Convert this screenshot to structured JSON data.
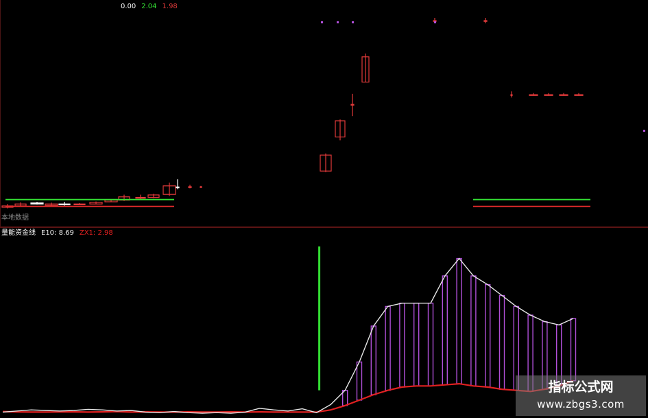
{
  "readout": {
    "main_prefix": "0.00",
    "main_mid": "2.04",
    "main_right": "1.98",
    "sub_label": "本地数据",
    "ind_name": "量能资金线",
    "ind_e10": "E10: 8.69",
    "ind_zx1": "ZX1: 2.98"
  },
  "colors": {
    "up": "#e23a3a",
    "down": "#ffffff",
    "e10": "#e6e6e6",
    "zx1": "#e02020",
    "bars": "#b04fd8",
    "green_line": "#33dd33",
    "red_line": "#dd2a2a",
    "divider": "#7a1a1a"
  },
  "watermark": {
    "title": "指标公式网",
    "url": "www.zbgs3.com"
  },
  "chart_data": [
    {
      "type": "candlestick",
      "panel": "price",
      "x": [
        0,
        1,
        2,
        3,
        4,
        5,
        6,
        7,
        8,
        9,
        10,
        11,
        12,
        13,
        14,
        15,
        16,
        17,
        18,
        19,
        20,
        21,
        22,
        23,
        24,
        25
      ],
      "candles": [
        {
          "x": 0,
          "open": 0.1,
          "close": 0.15,
          "high": 0.22,
          "low": 0.06
        },
        {
          "x": 1,
          "open": 0.15,
          "close": 0.22,
          "high": 0.28,
          "low": 0.12
        },
        {
          "x": 2,
          "open": 0.26,
          "close": 0.22,
          "high": 0.3,
          "low": 0.2
        },
        {
          "x": 3,
          "open": 0.17,
          "close": 0.22,
          "high": 0.27,
          "low": 0.13
        },
        {
          "x": 4,
          "open": 0.22,
          "close": 0.21,
          "high": 0.3,
          "low": 0.16
        },
        {
          "x": 5,
          "open": 0.2,
          "close": 0.22,
          "high": 0.25,
          "low": 0.18
        },
        {
          "x": 6,
          "open": 0.22,
          "close": 0.28,
          "high": 0.31,
          "low": 0.21
        },
        {
          "x": 7,
          "open": 0.3,
          "close": 0.36,
          "high": 0.4,
          "low": 0.29
        },
        {
          "x": 8,
          "open": 0.36,
          "close": 0.48,
          "high": 0.56,
          "low": 0.33
        },
        {
          "x": 9,
          "open": 0.45,
          "close": 0.46,
          "high": 0.56,
          "low": 0.4
        },
        {
          "x": 10,
          "open": 0.46,
          "close": 0.55,
          "high": 0.59,
          "low": 0.43
        },
        {
          "x": 11,
          "open": 0.57,
          "close": 0.88,
          "high": 1.0,
          "low": 0.51
        },
        {
          "x": 12,
          "open": 0.84,
          "close": 0.83,
          "high": 1.12,
          "low": 0.76
        },
        {
          "x": 13,
          "open": 0.83,
          "close": 0.85,
          "high": 0.92,
          "low": 0.79
        },
        {
          "x": 14,
          "open": 0.85,
          "close": 0.85,
          "high": 0.88,
          "low": 0.84
        },
        {
          "x": 15,
          "open": 1.42,
          "close": 2.0,
          "high": 2.06,
          "low": 1.38
        },
        {
          "x": 16,
          "open": 2.66,
          "close": 3.25,
          "high": 3.3,
          "low": 2.54
        },
        {
          "x": 17,
          "open": 3.85,
          "close": 3.85,
          "high": 4.23,
          "low": 3.42
        },
        {
          "x": 18,
          "open": 4.66,
          "close": 5.58,
          "high": 5.7,
          "low": 4.66
        },
        {
          "x": 19,
          "open": 6.9,
          "close": 6.9,
          "high": 7.0,
          "low": 6.8
        },
        {
          "x": 20,
          "open": 6.9,
          "close": 6.9,
          "high": 7.0,
          "low": 6.8
        },
        {
          "x": 21,
          "open": 4.2,
          "close": 4.2,
          "high": 4.32,
          "low": 4.1
        },
        {
          "x": 22,
          "open": 4.2,
          "close": 4.2,
          "high": 4.26,
          "low": 4.16
        },
        {
          "x": 23,
          "open": 4.2,
          "close": 4.2,
          "high": 4.26,
          "low": 4.16
        },
        {
          "x": 24,
          "open": 4.2,
          "close": 4.2,
          "high": 4.26,
          "low": 4.16
        },
        {
          "x": 25,
          "open": 4.2,
          "close": 4.2,
          "high": 4.26,
          "low": 4.16
        }
      ],
      "levels": [
        {
          "value": 0.38,
          "color": "green"
        },
        {
          "value": 0.13,
          "color": "red"
        }
      ],
      "ylim": [
        0,
        7.2
      ]
    },
    {
      "type": "line",
      "panel": "indicator",
      "x": [
        0,
        1,
        2,
        3,
        4,
        5,
        6,
        7,
        8,
        9,
        10,
        11,
        12,
        13,
        14,
        15,
        16,
        17,
        18,
        19,
        20,
        21,
        22,
        23,
        24,
        25,
        26,
        27,
        28,
        29,
        30,
        31,
        32,
        33,
        34,
        35,
        36,
        37,
        38,
        39,
        40
      ],
      "series": [
        {
          "key": "E10",
          "values": [
            0.1,
            0.2,
            0.3,
            0.25,
            0.2,
            0.25,
            0.35,
            0.3,
            0.2,
            0.25,
            0.1,
            0.05,
            0.15,
            0.05,
            0.0,
            0.05,
            0.0,
            0.1,
            0.45,
            0.3,
            0.2,
            0.4,
            0.05,
            0.8,
            2.1,
            4.7,
            8.0,
            9.8,
            10.1,
            10.1,
            10.1,
            12.6,
            14.2,
            12.6,
            11.8,
            10.8,
            9.8,
            9.0,
            8.4,
            8.1,
            8.69
          ]
        },
        {
          "key": "ZX1",
          "values": [
            0.15,
            0.12,
            0.1,
            0.1,
            0.12,
            0.12,
            0.1,
            0.12,
            0.15,
            0.1,
            0.12,
            0.1,
            0.1,
            0.12,
            0.1,
            0.1,
            0.12,
            0.1,
            0.12,
            0.1,
            0.1,
            0.1,
            0.1,
            0.3,
            0.7,
            1.2,
            1.7,
            2.1,
            2.4,
            2.5,
            2.5,
            2.6,
            2.7,
            2.5,
            2.4,
            2.2,
            2.1,
            2.0,
            2.2,
            2.5,
            2.98
          ]
        }
      ],
      "bars_from": 24,
      "spike": {
        "x": 22,
        "top": 15.3,
        "bottom": 2.1
      },
      "ylim": [
        0,
        16.0
      ]
    }
  ]
}
